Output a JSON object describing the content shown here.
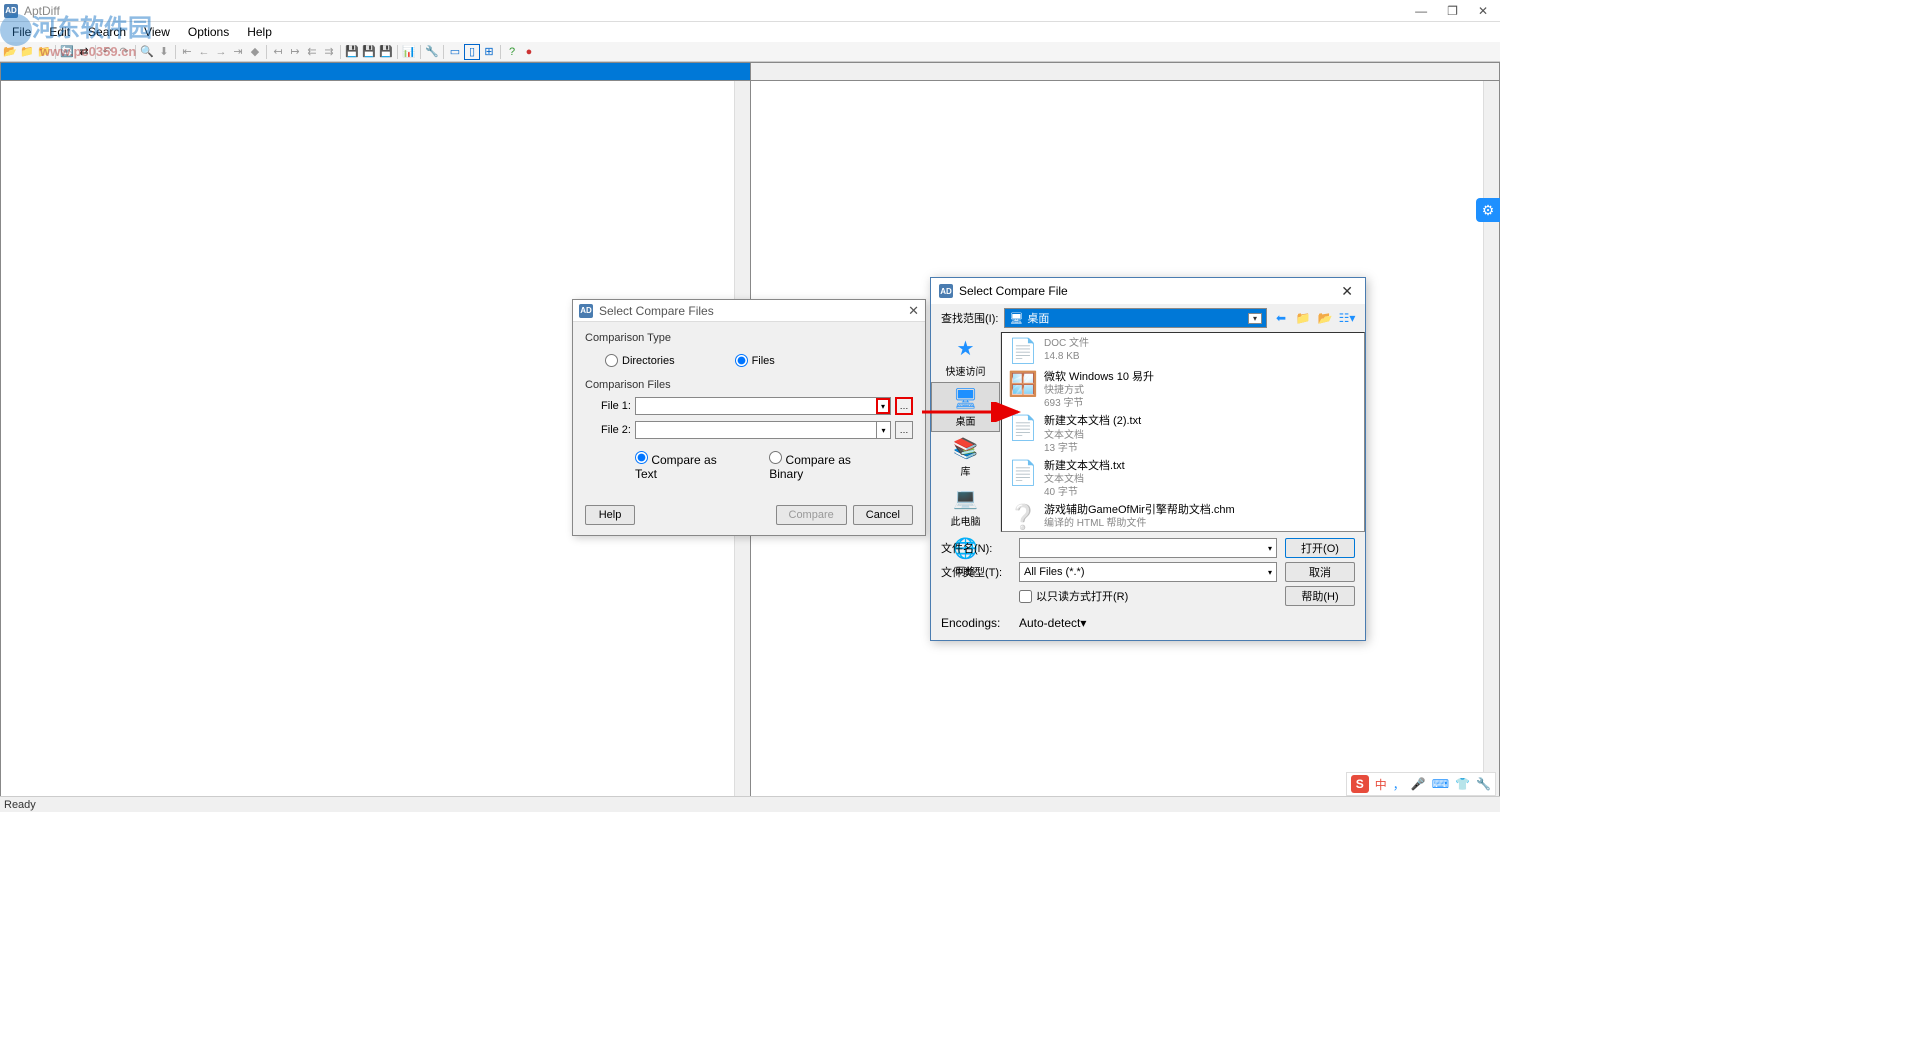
{
  "app": {
    "title": "AptDiff"
  },
  "window_controls": {
    "min": "—",
    "max": "❐",
    "close": "✕"
  },
  "menu": {
    "file": "File",
    "edit": "Edit",
    "search": "Search",
    "view": "View",
    "options": "Options",
    "help": "Help"
  },
  "watermark": {
    "text": "河东软件园",
    "url": "www.pc0359.cn"
  },
  "status": {
    "text": "Ready"
  },
  "dialog1": {
    "title": "Select Compare Files",
    "group1": "Comparison Type",
    "radio_dirs": "Directories",
    "radio_files": "Files",
    "group2": "Comparison Files",
    "file1_label": "File 1:",
    "file2_label": "File 2:",
    "radio_text": "Compare as Text",
    "radio_binary": "Compare as Binary",
    "help": "Help",
    "compare": "Compare",
    "cancel": "Cancel"
  },
  "dialog2": {
    "title": "Select Compare File",
    "look_in_label": "查找范围(I):",
    "look_in_value": "桌面",
    "side": {
      "quick": "快速访问",
      "desktop": "桌面",
      "lib": "库",
      "pc": "此电脑",
      "net": "网络"
    },
    "files": [
      {
        "name": "",
        "sub1": "DOC 文件",
        "sub2": "14.8 KB",
        "icon": "📄"
      },
      {
        "name": "微软 Windows 10 易升",
        "sub1": "快捷方式",
        "sub2": "693 字节",
        "icon": "🪟"
      },
      {
        "name": "新建文本文档 (2).txt",
        "sub1": "文本文档",
        "sub2": "13 字节",
        "icon": "📄"
      },
      {
        "name": "新建文本文档.txt",
        "sub1": "文本文档",
        "sub2": "40 字节",
        "icon": "📄"
      },
      {
        "name": "游戏辅助GameOfMir引擎帮助文档.chm",
        "sub1": "编译的 HTML 帮助文件",
        "sub2": "",
        "icon": "❔"
      }
    ],
    "filename_label": "文件名(N):",
    "filetype_label": "文件类型(T):",
    "filetype_value": "All Files (*.*)",
    "readonly": "以只读方式打开(R)",
    "enc_label": "Encodings:",
    "enc_value": "Auto-detect",
    "open": "打开(O)",
    "cancel": "取消",
    "help": "帮助(H)"
  },
  "ime": {
    "mode": "中",
    "sep": "，"
  }
}
